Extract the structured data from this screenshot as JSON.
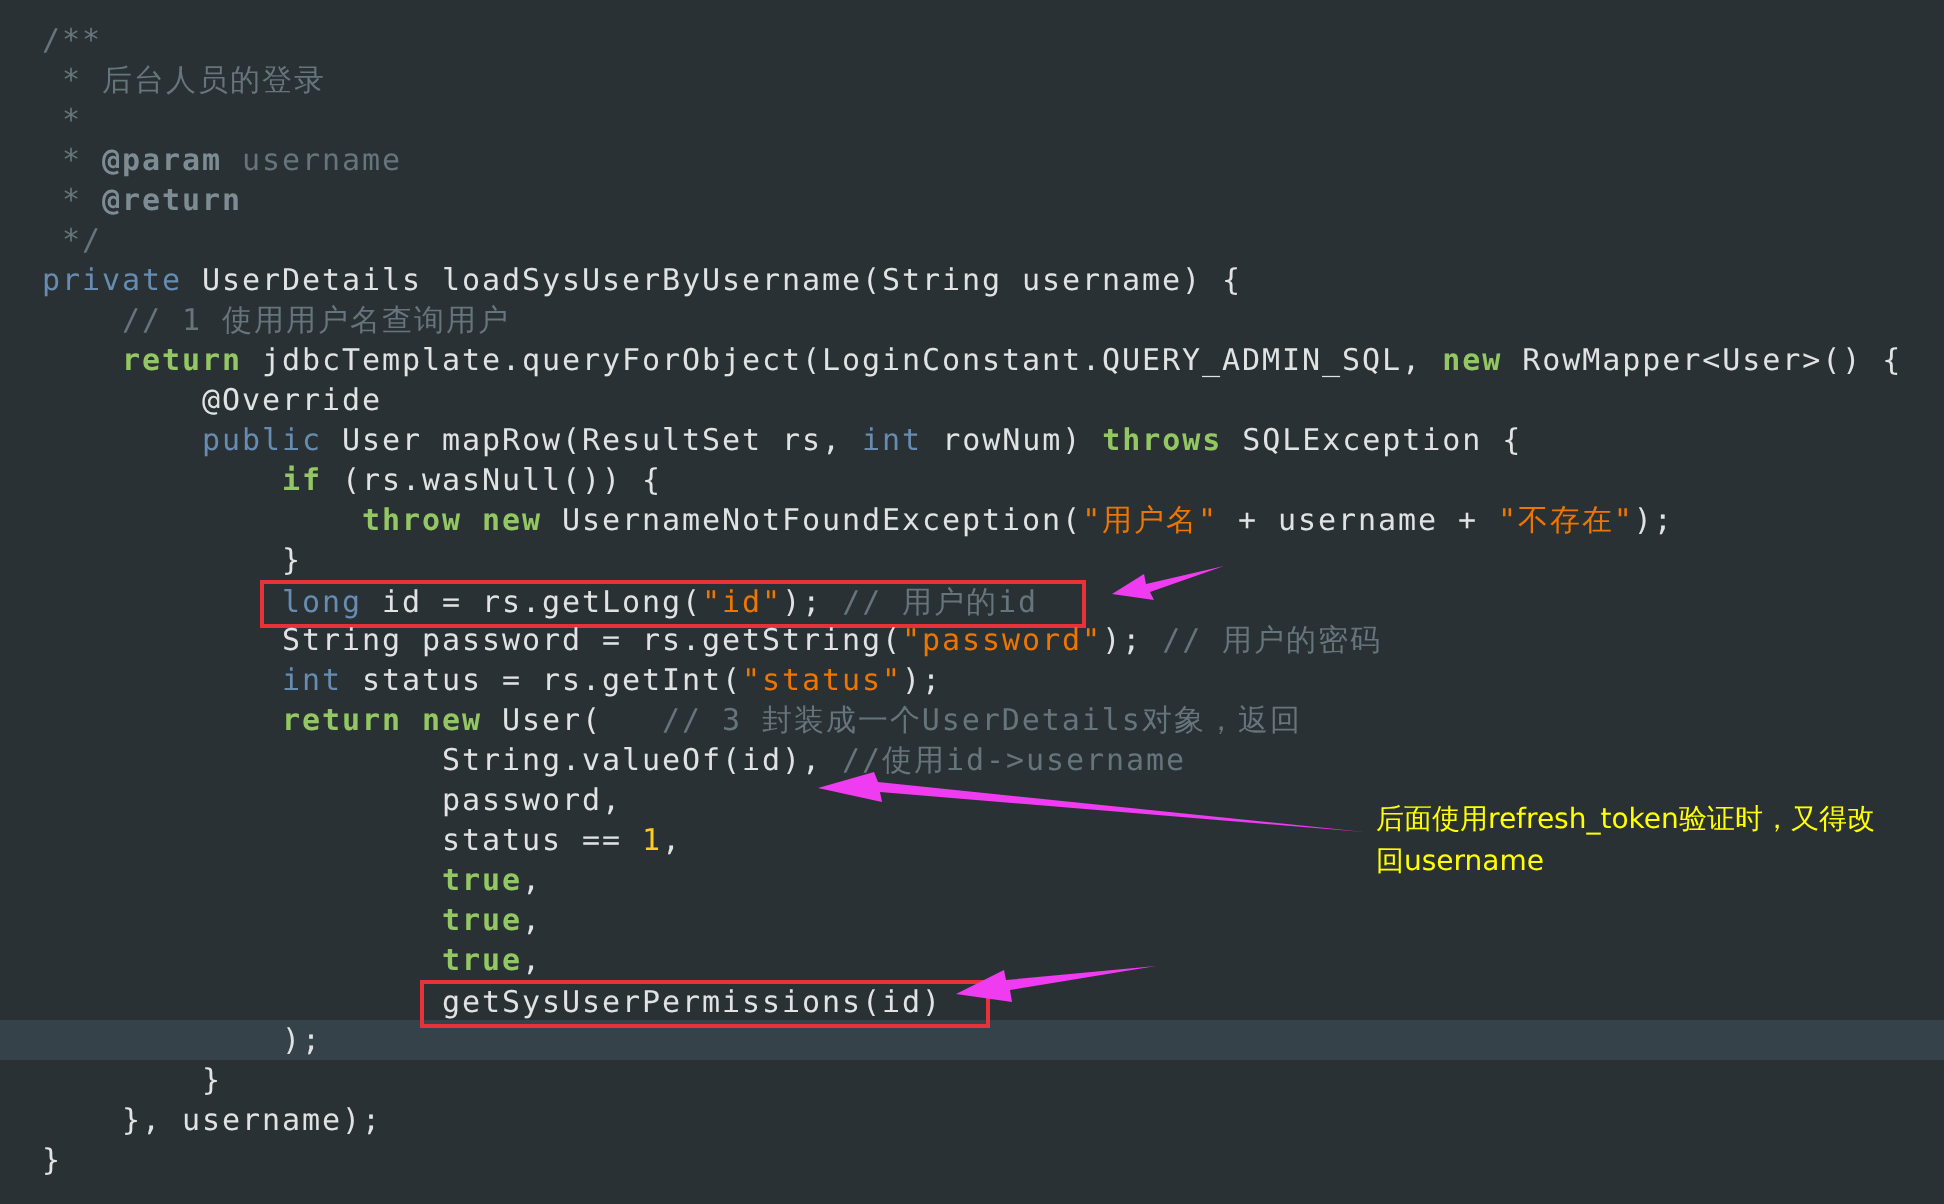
{
  "code": {
    "lines": [
      {
        "boxed": false,
        "current": false,
        "tokens": [
          {
            "text": "/**",
            "kind": "doc"
          }
        ]
      },
      {
        "boxed": false,
        "current": false,
        "tokens": [
          {
            "text": " * 后台人员的登录",
            "kind": "doc"
          }
        ]
      },
      {
        "boxed": false,
        "current": false,
        "tokens": [
          {
            "text": " *",
            "kind": "doc"
          }
        ]
      },
      {
        "boxed": false,
        "current": false,
        "tokens": [
          {
            "text": " * ",
            "kind": "doc"
          },
          {
            "text": "@param",
            "kind": "doctag"
          },
          {
            "text": " username",
            "kind": "doc"
          }
        ]
      },
      {
        "boxed": false,
        "current": false,
        "tokens": [
          {
            "text": " * ",
            "kind": "doc"
          },
          {
            "text": "@return",
            "kind": "doctag"
          }
        ]
      },
      {
        "boxed": false,
        "current": false,
        "tokens": [
          {
            "text": " */",
            "kind": "doc"
          }
        ]
      },
      {
        "boxed": false,
        "current": false,
        "tokens": [
          {
            "text": "private",
            "kind": "type"
          },
          {
            "text": " UserDetails loadSysUserByUsername(String username) {",
            "kind": "plain"
          }
        ]
      },
      {
        "boxed": false,
        "current": false,
        "tokens": [
          {
            "text": "    // 1 使用用户名查询用户",
            "kind": "comment"
          }
        ]
      },
      {
        "boxed": false,
        "current": false,
        "tokens": [
          {
            "text": "    return",
            "kind": "keyword"
          },
          {
            "text": " jdbcTemplate.queryForObject(LoginConstant.QUERY_ADMIN_SQL, ",
            "kind": "plain"
          },
          {
            "text": "new",
            "kind": "keyword"
          },
          {
            "text": " RowMapper<User>() {",
            "kind": "plain"
          }
        ]
      },
      {
        "boxed": false,
        "current": false,
        "tokens": [
          {
            "text": "        @Override",
            "kind": "plain"
          }
        ]
      },
      {
        "boxed": false,
        "current": false,
        "tokens": [
          {
            "text": "        public",
            "kind": "type"
          },
          {
            "text": " User mapRow(ResultSet rs, ",
            "kind": "plain"
          },
          {
            "text": "int",
            "kind": "type"
          },
          {
            "text": " rowNum) ",
            "kind": "plain"
          },
          {
            "text": "throws",
            "kind": "keyword"
          },
          {
            "text": " SQLException {",
            "kind": "plain"
          }
        ]
      },
      {
        "boxed": false,
        "current": false,
        "tokens": [
          {
            "text": "            if",
            "kind": "keyword"
          },
          {
            "text": " (rs.wasNull()) {",
            "kind": "plain"
          }
        ]
      },
      {
        "boxed": false,
        "current": false,
        "tokens": [
          {
            "text": "                throw new",
            "kind": "keyword"
          },
          {
            "text": " UsernameNotFoundException(",
            "kind": "plain"
          },
          {
            "text": "\"用户名\"",
            "kind": "string"
          },
          {
            "text": " + username + ",
            "kind": "plain"
          },
          {
            "text": "\"不存在\"",
            "kind": "string"
          },
          {
            "text": ");",
            "kind": "plain"
          }
        ]
      },
      {
        "boxed": false,
        "current": false,
        "tokens": [
          {
            "text": "            }",
            "kind": "plain"
          }
        ]
      },
      {
        "boxed": true,
        "current": false,
        "tokens": [
          {
            "text": "            long",
            "kind": "type"
          },
          {
            "text": " id = rs.getLong(",
            "kind": "plain"
          },
          {
            "text": "\"id\"",
            "kind": "string"
          },
          {
            "text": "); ",
            "kind": "plain"
          },
          {
            "text": "// 用户的id",
            "kind": "comment"
          }
        ]
      },
      {
        "boxed": false,
        "current": false,
        "tokens": [
          {
            "text": "            String password = rs.getString(",
            "kind": "plain"
          },
          {
            "text": "\"password\"",
            "kind": "string"
          },
          {
            "text": "); ",
            "kind": "plain"
          },
          {
            "text": "// 用户的密码",
            "kind": "comment"
          }
        ]
      },
      {
        "boxed": false,
        "current": false,
        "tokens": [
          {
            "text": "            int",
            "kind": "type"
          },
          {
            "text": " status = rs.getInt(",
            "kind": "plain"
          },
          {
            "text": "\"status\"",
            "kind": "string"
          },
          {
            "text": ");",
            "kind": "plain"
          }
        ]
      },
      {
        "boxed": false,
        "current": false,
        "tokens": [
          {
            "text": "            return new",
            "kind": "keyword"
          },
          {
            "text": " User(   ",
            "kind": "plain"
          },
          {
            "text": "// 3 封装成一个UserDetails对象，返回",
            "kind": "comment"
          }
        ]
      },
      {
        "boxed": false,
        "current": false,
        "tokens": [
          {
            "text": "                    String.valueOf(id), ",
            "kind": "plain"
          },
          {
            "text": "//使用id->username",
            "kind": "comment"
          }
        ]
      },
      {
        "boxed": false,
        "current": false,
        "tokens": [
          {
            "text": "                    password,",
            "kind": "plain"
          }
        ]
      },
      {
        "boxed": false,
        "current": false,
        "tokens": [
          {
            "text": "                    status == ",
            "kind": "plain"
          },
          {
            "text": "1",
            "kind": "number"
          },
          {
            "text": ",",
            "kind": "plain"
          }
        ]
      },
      {
        "boxed": false,
        "current": false,
        "tokens": [
          {
            "text": "                    true",
            "kind": "keyword"
          },
          {
            "text": ",",
            "kind": "plain"
          }
        ]
      },
      {
        "boxed": false,
        "current": false,
        "tokens": [
          {
            "text": "                    true",
            "kind": "keyword"
          },
          {
            "text": ",",
            "kind": "plain"
          }
        ]
      },
      {
        "boxed": false,
        "current": false,
        "tokens": [
          {
            "text": "                    true",
            "kind": "keyword"
          },
          {
            "text": ",",
            "kind": "plain"
          }
        ]
      },
      {
        "boxed": true,
        "current": false,
        "tokens": [
          {
            "text": "                    getSysUserPermissions(id)",
            "kind": "plain"
          }
        ]
      },
      {
        "boxed": false,
        "current": true,
        "tokens": [
          {
            "text": "            );",
            "kind": "plain"
          }
        ]
      },
      {
        "boxed": false,
        "current": false,
        "tokens": [
          {
            "text": "        }",
            "kind": "plain"
          }
        ]
      },
      {
        "boxed": false,
        "current": false,
        "tokens": [
          {
            "text": "    }, username);",
            "kind": "plain"
          }
        ]
      },
      {
        "boxed": false,
        "current": false,
        "tokens": [
          {
            "text": "}",
            "kind": "plain"
          }
        ]
      }
    ]
  },
  "annotation": {
    "text": "后面使用refresh_token验证时，又得改回username"
  }
}
